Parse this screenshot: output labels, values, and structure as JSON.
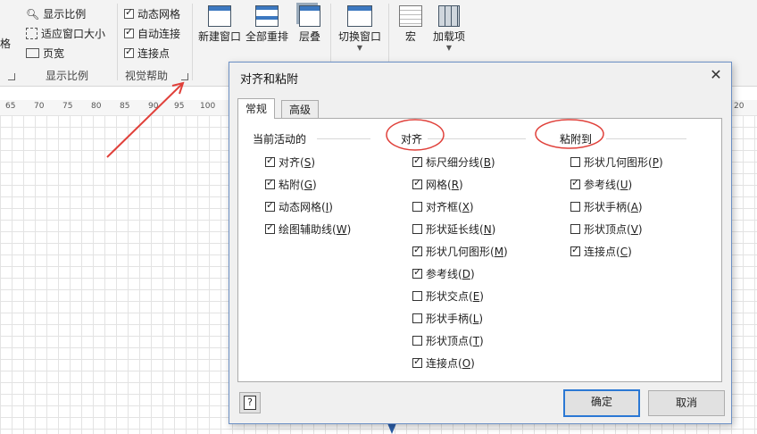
{
  "ribbon": {
    "zoom_group": {
      "cut_label": "格",
      "items": [
        "显示比例",
        "适应窗口大小",
        "页宽"
      ],
      "caption": "显示比例"
    },
    "visual_aids": {
      "items": [
        {
          "label": "动态网格",
          "checked": true
        },
        {
          "label": "自动连接",
          "checked": true
        },
        {
          "label": "连接点",
          "checked": true
        }
      ],
      "caption": "视觉帮助"
    },
    "window_group": {
      "buttons": [
        "新建窗口",
        "全部重排",
        "层叠",
        "切换窗口"
      ]
    },
    "macro_group": {
      "buttons": [
        "宏",
        "加载项"
      ]
    }
  },
  "ruler": {
    "ticks": [
      "65",
      "70",
      "75",
      "80",
      "85",
      "90",
      "95",
      "100",
      "20"
    ]
  },
  "dialog": {
    "title": "对齐和粘附",
    "close_glyph": "✕",
    "tabs": [
      "常规",
      "高级"
    ],
    "columns": [
      {
        "header": "当前活动的",
        "options": [
          {
            "label": "对齐(",
            "key": "S",
            "suffix": ")",
            "checked": true
          },
          {
            "label": "粘附(",
            "key": "G",
            "suffix": ")",
            "checked": true
          },
          {
            "label": "动态网格(",
            "key": "I",
            "suffix": ")",
            "checked": true
          },
          {
            "label": "绘图辅助线(",
            "key": "W",
            "suffix": ")",
            "checked": true
          }
        ]
      },
      {
        "header": "对齐",
        "options": [
          {
            "label": "标尺细分线(",
            "key": "B",
            "suffix": ")",
            "checked": true
          },
          {
            "label": "网格(",
            "key": "R",
            "suffix": ")",
            "checked": true
          },
          {
            "label": "对齐框(",
            "key": "X",
            "suffix": ")",
            "checked": false
          },
          {
            "label": "形状延长线(",
            "key": "N",
            "suffix": ")",
            "checked": false
          },
          {
            "label": "形状几何图形(",
            "key": "M",
            "suffix": ")",
            "checked": true
          },
          {
            "label": "参考线(",
            "key": "D",
            "suffix": ")",
            "checked": true
          },
          {
            "label": "形状交点(",
            "key": "E",
            "suffix": ")",
            "checked": false
          },
          {
            "label": "形状手柄(",
            "key": "L",
            "suffix": ")",
            "checked": false
          },
          {
            "label": "形状顶点(",
            "key": "T",
            "suffix": ")",
            "checked": false
          },
          {
            "label": "连接点(",
            "key": "O",
            "suffix": ")",
            "checked": true
          }
        ]
      },
      {
        "header": "粘附到",
        "options": [
          {
            "label": "形状几何图形(",
            "key": "P",
            "suffix": ")",
            "checked": false
          },
          {
            "label": "参考线(",
            "key": "U",
            "suffix": ")",
            "checked": true
          },
          {
            "label": "形状手柄(",
            "key": "A",
            "suffix": ")",
            "checked": false
          },
          {
            "label": "形状顶点(",
            "key": "V",
            "suffix": ")",
            "checked": false
          },
          {
            "label": "连接点(",
            "key": "C",
            "suffix": ")",
            "checked": true
          }
        ]
      }
    ],
    "help_glyph": "?",
    "ok_label": "确定",
    "cancel_label": "取消"
  },
  "colors": {
    "annotation": "#e0403a",
    "accent": "#2b78d4"
  }
}
